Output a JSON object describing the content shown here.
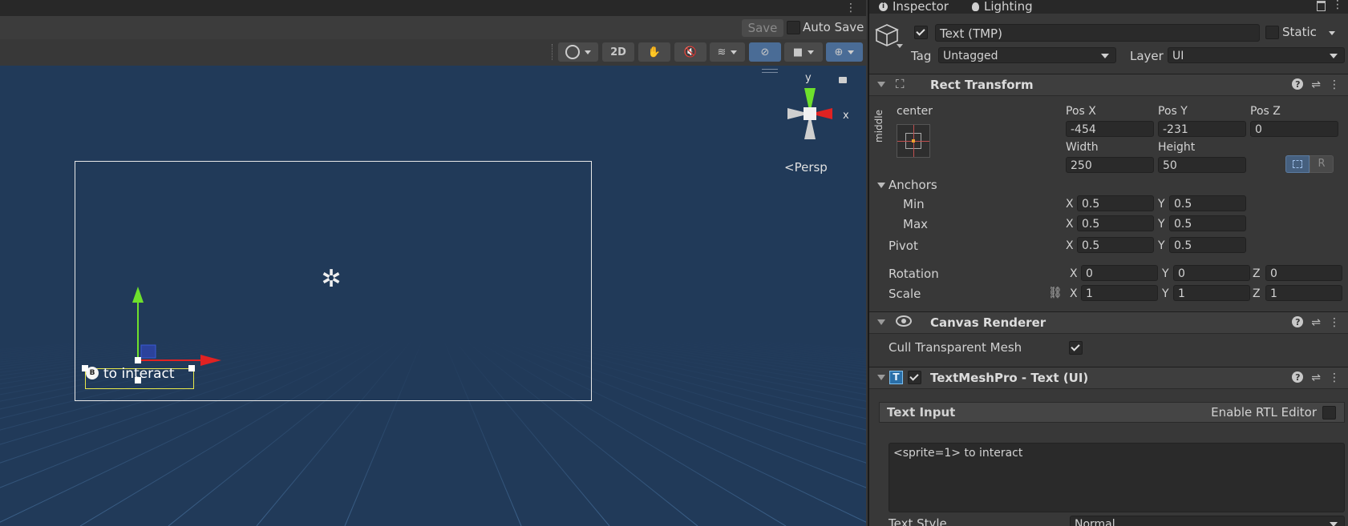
{
  "scene": {
    "save_label": "Save",
    "autosave_label": "Auto Save",
    "toolbar": {
      "btn_2d": "2D"
    },
    "persp_label": "Persp",
    "gizmo": {
      "y": "y",
      "x": "x"
    },
    "text_object": {
      "label": "to interact",
      "sprite_glyph": "B"
    }
  },
  "inspector": {
    "tabs": [
      {
        "label": "Inspector",
        "icon": "info-icon"
      },
      {
        "label": "Lighting",
        "icon": "bulb-icon"
      }
    ],
    "object": {
      "name": "Text (TMP)",
      "active": true,
      "static_label": "Static",
      "tag_label": "Tag",
      "tag_value": "Untagged",
      "layer_label": "Layer",
      "layer_value": "UI"
    },
    "rect_transform": {
      "title": "Rect Transform",
      "anchor_h": "center",
      "anchor_v": "middle",
      "pos_x_label": "Pos X",
      "pos_x": "-454",
      "pos_y_label": "Pos Y",
      "pos_y": "-231",
      "pos_z_label": "Pos Z",
      "pos_z": "0",
      "width_label": "Width",
      "width": "250",
      "height_label": "Height",
      "height": "50",
      "raw_edit": "R",
      "anchors_label": "Anchors",
      "min_label": "Min",
      "min_x": "0.5",
      "min_y": "0.5",
      "max_label": "Max",
      "max_x": "0.5",
      "max_y": "0.5",
      "pivot_label": "Pivot",
      "pivot_x": "0.5",
      "pivot_y": "0.5",
      "rotation_label": "Rotation",
      "rot_x": "0",
      "rot_y": "0",
      "rot_z": "0",
      "scale_label": "Scale",
      "scale_x": "1",
      "scale_y": "1",
      "scale_z": "1",
      "axis_x": "X",
      "axis_y": "Y",
      "axis_z": "Z"
    },
    "canvas_renderer": {
      "title": "Canvas Renderer",
      "cull_label": "Cull Transparent Mesh",
      "cull_value": true
    },
    "tmp": {
      "title": "TextMeshPro - Text (UI)",
      "icon_glyph": "T",
      "text_input_label": "Text Input",
      "rtl_label": "Enable RTL Editor",
      "text_value": "<sprite=1> to interact",
      "style_label": "Text Style",
      "style_value": "Normal"
    }
  },
  "colors": {
    "viewport_bg": "#213a59",
    "accent": "#4a6c96",
    "gizmo_x": "#e02222",
    "gizmo_y": "#6ee02c",
    "selection": "#e8e84a"
  }
}
